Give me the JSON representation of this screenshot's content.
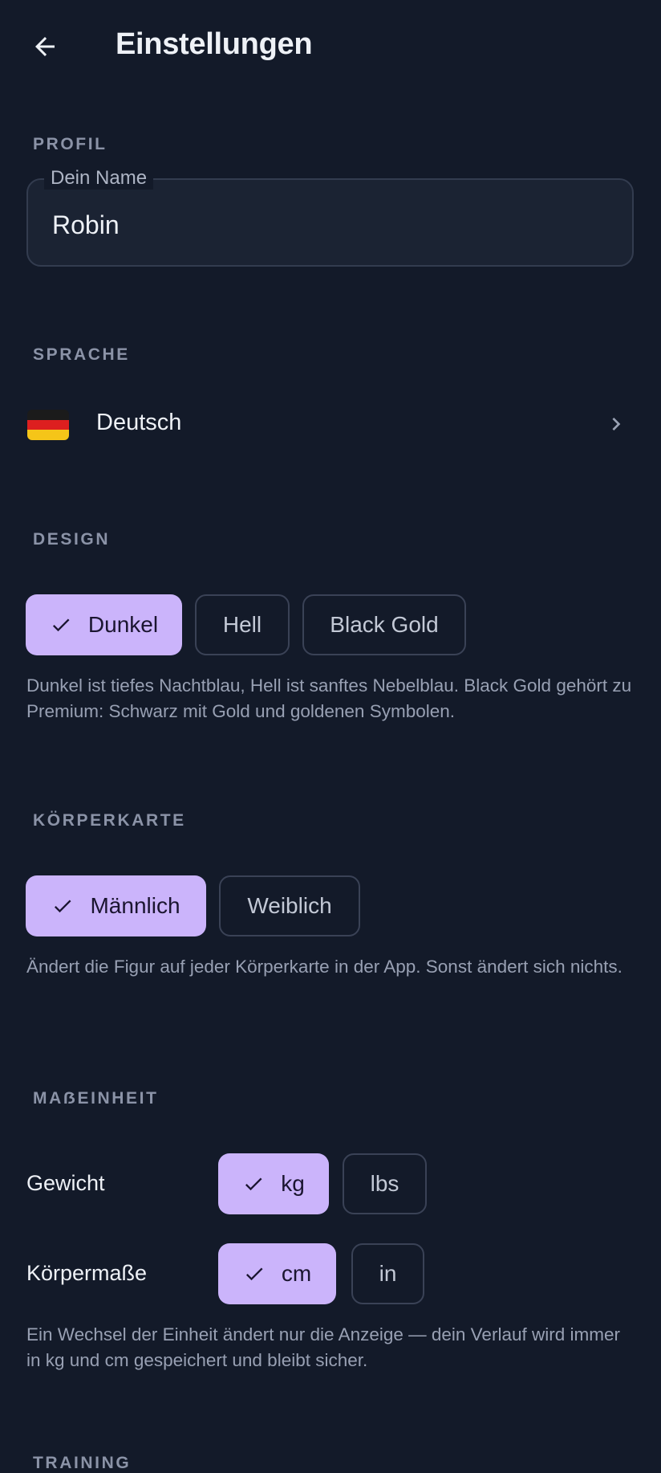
{
  "header": {
    "title": "Einstellungen",
    "back_icon": "arrow-left-icon"
  },
  "profile": {
    "section_label": "PROFIL",
    "name_label": "Dein Name",
    "name_value": "Robin"
  },
  "language": {
    "section_label": "SPRACHE",
    "flag_icon": "flag-germany-icon",
    "current": "Deutsch",
    "chevron_icon": "chevron-right-icon"
  },
  "design": {
    "section_label": "DESIGN",
    "options": [
      "Dunkel",
      "Hell",
      "Black Gold"
    ],
    "selected": "Dunkel",
    "description": "Dunkel ist tiefes Nachtblau, Hell ist sanftes Nebelblau. Black Gold gehört zu Premium: Schwarz mit Gold und goldenen Symbolen."
  },
  "body_map": {
    "section_label": "KÖRPERKARTE",
    "options": [
      "Männlich",
      "Weiblich"
    ],
    "selected": "Männlich",
    "description": "Ändert die Figur auf jeder Körperkarte in der App. Sonst ändert sich nichts."
  },
  "units": {
    "section_label": "MAẞEINHEIT",
    "weight_label": "Gewicht",
    "weight_options": [
      "kg",
      "lbs"
    ],
    "weight_selected": "kg",
    "measure_label": "Körpermaße",
    "measure_options": [
      "cm",
      "in"
    ],
    "measure_selected": "cm",
    "description": "Ein Wechsel der Einheit ändert nur die Anzeige — dein Verlauf wird immer in kg und cm gespeichert und bleibt sicher."
  },
  "training": {
    "section_label": "TRAINING"
  },
  "colors": {
    "background": "#131a29",
    "accent": "#cbb4fb",
    "section_label": "#8b93a7",
    "chip_border": "#3a4256"
  }
}
